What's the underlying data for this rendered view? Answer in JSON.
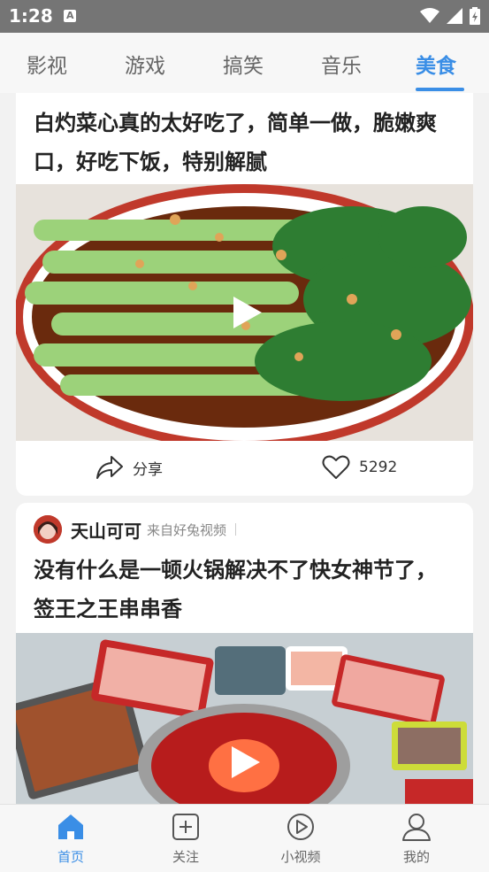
{
  "status_bar": {
    "time": "1:28"
  },
  "tabs": [
    {
      "label": "影视"
    },
    {
      "label": "游戏"
    },
    {
      "label": "搞笑"
    },
    {
      "label": "音乐"
    },
    {
      "label": "美食"
    }
  ],
  "feed": [
    {
      "title": "白灼菜心真的太好吃了，简单一做，脆嫩爽口，好吃下饭，特别解腻",
      "share_label": "分享",
      "likes": "5292"
    },
    {
      "author": "天山可可",
      "source": "来自好兔视频",
      "title": "没有什么是一顿火锅解决不了快女神节了，签王之王串串香"
    }
  ],
  "bottom_nav": [
    {
      "label": "首页"
    },
    {
      "label": "关注"
    },
    {
      "label": "小视频"
    },
    {
      "label": "我的"
    }
  ],
  "colors": {
    "accent": "#3a8ee6",
    "status_bar": "#757575"
  }
}
